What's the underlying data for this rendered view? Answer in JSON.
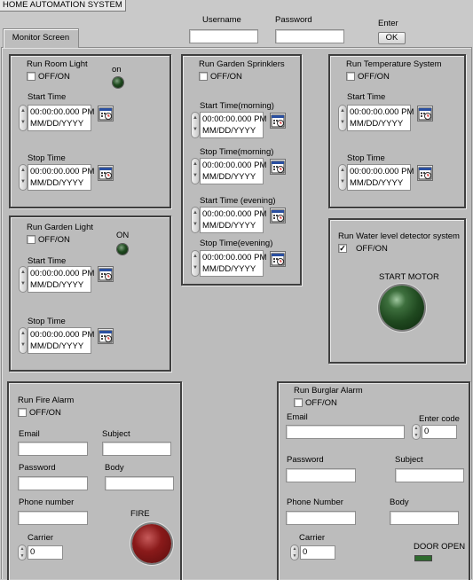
{
  "window": {
    "title": "HOME AUTOMATION SYSTEM"
  },
  "header": {
    "username_label": "Username",
    "password_label": "Password",
    "enter_label": "Enter",
    "ok_button": "OK",
    "username_value": "",
    "password_value": ""
  },
  "tabs": [
    {
      "label": "Monitor Screen"
    }
  ],
  "room_light": {
    "title": "Run Room Light",
    "toggle_label": "OFF/ON",
    "indicator_label": "on",
    "start_label": "Start Time",
    "start_time": "00:00:00.000 PM",
    "start_date": "MM/DD/YYYY",
    "stop_label": "Stop Time",
    "stop_time": "00:00:00.000 PM",
    "stop_date": "MM/DD/YYYY"
  },
  "garden_light": {
    "title": "Run Garden Light",
    "toggle_label": "OFF/ON",
    "indicator_label": "ON",
    "start_label": "Start Time",
    "start_time": "00:00:00.000 PM",
    "start_date": "MM/DD/YYYY",
    "stop_label": "Stop Time",
    "stop_time": "00:00:00.000 PM",
    "stop_date": "MM/DD/YYYY"
  },
  "sprinklers": {
    "title": "Run Garden Sprinklers",
    "toggle_label": "OFF/ON",
    "times": [
      {
        "label": "Start Time(morning)",
        "time": "00:00:00.000 PM",
        "date": "MM/DD/YYYY"
      },
      {
        "label": "Stop Time(morning)",
        "time": "00:00:00.000 PM",
        "date": "MM/DD/YYYY"
      },
      {
        "label": "Start Time (evening)",
        "time": "00:00:00.000 PM",
        "date": "MM/DD/YYYY"
      },
      {
        "label": "Stop Time(evening)",
        "time": "00:00:00.000 PM",
        "date": "MM/DD/YYYY"
      }
    ]
  },
  "temperature": {
    "title": "Run Temperature System",
    "toggle_label": "OFF/ON",
    "start_label": "Start Time",
    "start_time": "00:00:00.000 PM",
    "start_date": "MM/DD/YYYY",
    "stop_label": "Stop Time",
    "stop_time": "00:00:00.000 PM",
    "stop_date": "MM/DD/YYYY"
  },
  "water_level": {
    "title": "Run Water level detector system",
    "toggle_label": "OFF/ON",
    "checked": true,
    "check_mark": "✓",
    "motor_label": "START MOTOR"
  },
  "fire_alarm": {
    "title": "Run Fire Alarm",
    "toggle_label": "OFF/ON",
    "email_label": "Email",
    "subject_label": "Subject",
    "password_label": "Password",
    "body_label": "Body",
    "phone_label": "Phone number",
    "carrier_label": "Carrier",
    "carrier_value": "0",
    "fire_label": "FIRE"
  },
  "burglar_alarm": {
    "title": "Run Burglar Alarm",
    "toggle_label": "OFF/ON",
    "email_label": "Email",
    "code_label": "Enter code",
    "code_value": "0",
    "password_label": "Password",
    "subject_label": "Subject",
    "phone_label": "Phone Number",
    "body_label": "Body",
    "carrier_label": "Carrier",
    "carrier_value": "0",
    "door_label": "DOOR OPEN"
  },
  "icons": {
    "calendar": "calendar-clock-icon",
    "spinner": "increment-decrement-icon",
    "indicator": "led-indicator"
  },
  "colors": {
    "background": "#c9c9c9",
    "led_green": "#1f481f",
    "led_red": "#8a1a1a",
    "door_led": "#2e6b2e"
  }
}
